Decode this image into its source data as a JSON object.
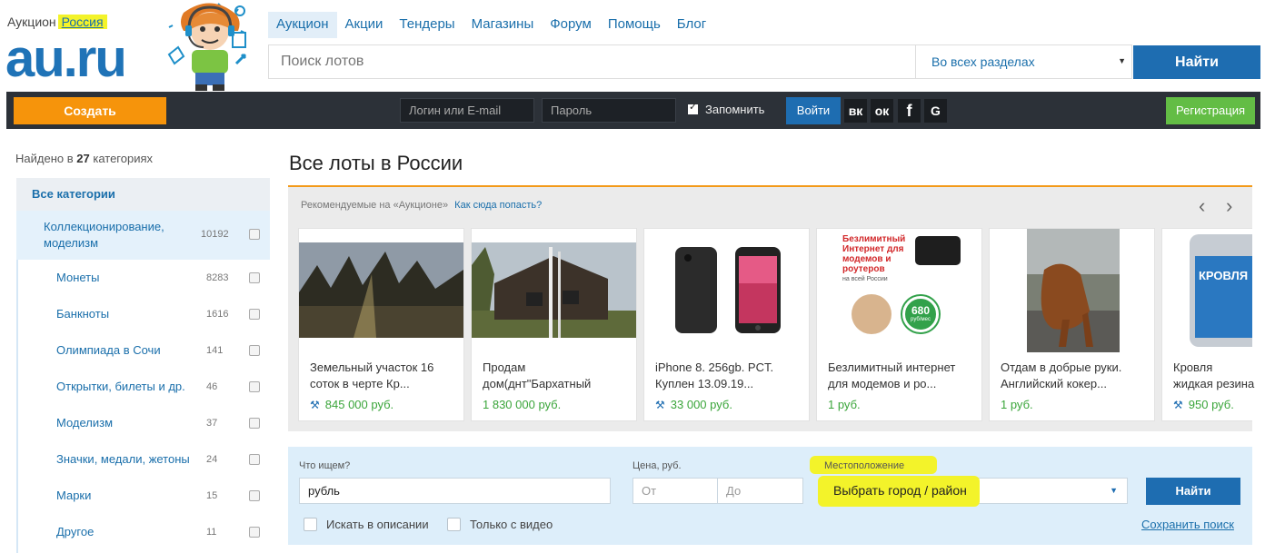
{
  "header": {
    "brand_caption": "Аукцион",
    "region": "Россия",
    "logo": "au.ru"
  },
  "nav": {
    "items": [
      "Аукцион",
      "Акции",
      "Тендеры",
      "Магазины",
      "Форум",
      "Помощь",
      "Блог"
    ]
  },
  "search": {
    "placeholder": "Поиск лотов",
    "section": "Во всех разделах",
    "button": "Найти"
  },
  "topbar": {
    "create": "Создать",
    "login_placeholder": "Логин или E-mail",
    "password_placeholder": "Пароль",
    "remember": "Запомнить",
    "enter": "Войти",
    "socials": [
      "вк",
      "ок",
      "f",
      "G"
    ],
    "register": "Регистрация"
  },
  "sidebar": {
    "found_prefix": "Найдено в",
    "found_count": "27",
    "found_suffix": "категориях",
    "all_categories": "Все категории",
    "main_category": {
      "label": "Коллекционирование, моделизм",
      "count": "10192"
    },
    "subcategories": [
      {
        "label": "Монеты",
        "count": "8283"
      },
      {
        "label": "Банкноты",
        "count": "1616"
      },
      {
        "label": "Олимпиада в Сочи",
        "count": "141"
      },
      {
        "label": "Открытки, билеты и др.",
        "count": "46"
      },
      {
        "label": "Моделизм",
        "count": "37"
      },
      {
        "label": "Значки, медали, жетоны",
        "count": "24"
      },
      {
        "label": "Марки",
        "count": "15"
      },
      {
        "label": "Другое",
        "count": "11"
      }
    ]
  },
  "main": {
    "title": "Все лоты в России",
    "featured_label": "Рекомендуемые на «Аукционе»",
    "featured_link": "Как сюда попасть?",
    "cards": [
      {
        "title": "Земельный участок 16 соток в черте Кр...",
        "price": "845 000 руб.",
        "auction": true
      },
      {
        "title": "Продам дом(днт\"Бархатный",
        "price": "1 830 000 руб.",
        "auction": false
      },
      {
        "title": "iPhone 8. 256gb. PCT. Куплен 13.09.19...",
        "price": "33 000 руб.",
        "auction": true
      },
      {
        "title": "Безлимитный интернет для модемов и ро...",
        "price": "1 руб.",
        "auction": false
      },
      {
        "title": "Отдам в добрые руки. Английский кокер...",
        "price": "1 руб.",
        "auction": false
      },
      {
        "title": "Кровля жидкая резина для кр",
        "price": "950 руб.",
        "auction": true
      }
    ],
    "promo_text": "Безлимитный Интернет для модемов и роутеров",
    "promo_sub": "на всей России",
    "promo_badge": "680",
    "promo_badge_unit": "руб/мес",
    "roof_text": "КРОВЛЯ"
  },
  "filter": {
    "query_label": "Что ищем?",
    "query_value": "рубль",
    "price_label": "Цена, руб.",
    "price_from": "От",
    "price_to": "До",
    "location_label": "Местоположение",
    "location_value": "Выбрать город / район",
    "find": "Найти",
    "search_desc": "Искать в описании",
    "video_only": "Только с видео",
    "save_search": "Сохранить поиск"
  }
}
